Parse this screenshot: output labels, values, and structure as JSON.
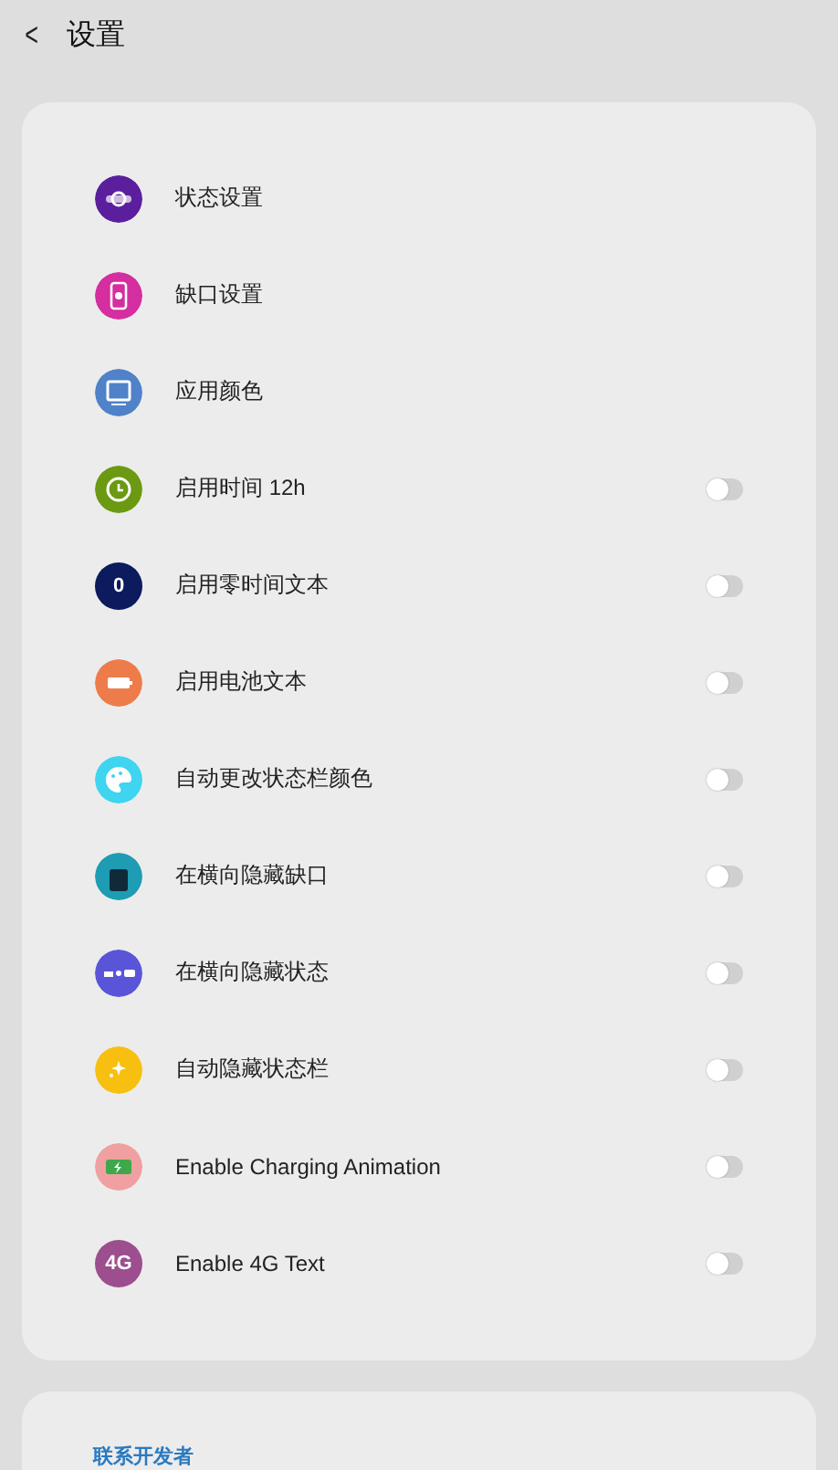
{
  "header": {
    "back": "<",
    "title": "设置"
  },
  "settings": [
    {
      "kind": "link",
      "label": "状态设置",
      "color": "#5b1f9e"
    },
    {
      "kind": "link",
      "label": "缺口设置",
      "color": "#d42ea0"
    },
    {
      "kind": "link",
      "label": "应用颜色",
      "color": "#4f82c8"
    },
    {
      "kind": "switch",
      "label": "启用时间 12h",
      "color": "#6b9a12",
      "on": false
    },
    {
      "kind": "switch",
      "label": "启用零时间文本",
      "color": "#0c1a5e",
      "glyph": "0",
      "on": false
    },
    {
      "kind": "switch",
      "label": "启用电池文本",
      "color": "#ee7c4a",
      "on": false
    },
    {
      "kind": "switch",
      "label": "自动更改状态栏颜色",
      "color": "#3fd4f0",
      "on": false
    },
    {
      "kind": "switch",
      "label": "在横向隐藏缺口",
      "color": "#1e9cb4",
      "on": false
    },
    {
      "kind": "switch",
      "label": "在横向隐藏状态",
      "color": "#5a55d8",
      "on": false
    },
    {
      "kind": "switch",
      "label": "自动隐藏状态栏",
      "color": "#f7c010",
      "on": false
    },
    {
      "kind": "switch",
      "label": "Enable Charging Animation",
      "color": "#f0a0a0",
      "on": false
    },
    {
      "kind": "switch",
      "label": "Enable 4G Text",
      "color": "#9c4e8e",
      "glyph": "4G",
      "on": false
    }
  ],
  "contact": {
    "title": "联系开发者"
  }
}
